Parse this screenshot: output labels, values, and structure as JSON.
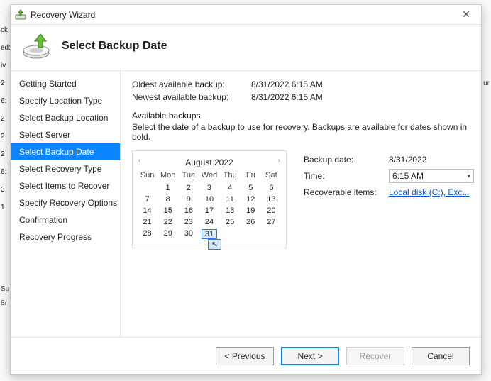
{
  "window": {
    "title": "Recovery Wizard",
    "close_glyph": "✕"
  },
  "header": {
    "title": "Select Backup Date"
  },
  "sidebar": {
    "items": [
      {
        "label": "Getting Started"
      },
      {
        "label": "Specify Location Type"
      },
      {
        "label": "Select Backup Location"
      },
      {
        "label": "Select Server"
      },
      {
        "label": "Select Backup Date"
      },
      {
        "label": "Select Recovery Type"
      },
      {
        "label": "Select Items to Recover"
      },
      {
        "label": "Specify Recovery Options"
      },
      {
        "label": "Confirmation"
      },
      {
        "label": "Recovery Progress"
      }
    ],
    "selected_index": 4
  },
  "info": {
    "oldest_label": "Oldest available backup:",
    "oldest_value": "8/31/2022 6:15 AM",
    "newest_label": "Newest available backup:",
    "newest_value": "8/31/2022 6:15 AM",
    "available_heading": "Available backups",
    "available_desc": "Select the date of a backup to use for recovery. Backups are available for dates shown in bold."
  },
  "calendar": {
    "month_label": "August 2022",
    "prev_glyph": "‹",
    "next_glyph": "›",
    "dow": [
      "Sun",
      "Mon",
      "Tue",
      "Wed",
      "Thu",
      "Fri",
      "Sat"
    ],
    "cells": [
      "",
      "1",
      "2",
      "3",
      "4",
      "5",
      "6",
      "7",
      "8",
      "9",
      "10",
      "11",
      "12",
      "13",
      "14",
      "15",
      "16",
      "17",
      "18",
      "19",
      "20",
      "21",
      "22",
      "23",
      "24",
      "25",
      "26",
      "27",
      "28",
      "29",
      "30",
      "31",
      "",
      "",
      ""
    ],
    "selected_value": "31"
  },
  "details": {
    "backup_date_label": "Backup date:",
    "backup_date_value": "8/31/2022",
    "time_label": "Time:",
    "time_value": "6:15 AM",
    "recoverable_label": "Recoverable items:",
    "recoverable_link": "Local disk (C:), Exc..."
  },
  "footer": {
    "previous": "< Previous",
    "next": "Next >",
    "recover": "Recover",
    "cancel": "Cancel"
  },
  "bg": {
    "left_fragments": [
      "ck",
      "ed:",
      "iv",
      "2 6:",
      "2",
      "2",
      "2 6:",
      "3",
      "1"
    ],
    "right_fragment": "ur",
    "left_bottom": [
      "Su",
      "8/"
    ]
  }
}
